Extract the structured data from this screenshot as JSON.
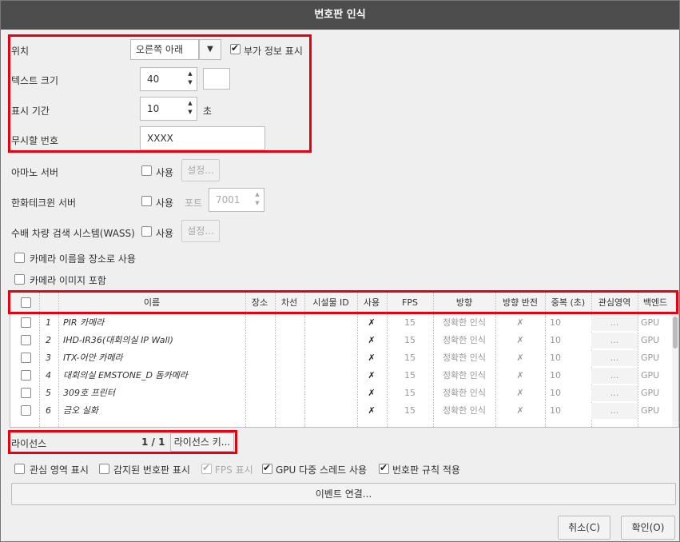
{
  "title": "번호판 인식",
  "display": {
    "position_label": "위치",
    "position_value": "오른쪽 아래",
    "extra_info_label": "부가 정보 표시",
    "text_size_label": "텍스트 크기",
    "text_size_value": "40",
    "duration_label": "표시 기간",
    "duration_value": "10",
    "duration_unit": "초",
    "ignore_label": "무시할 번호",
    "ignore_value": "XXXX"
  },
  "servers": {
    "amano_label": "아마노 서버",
    "use_label": "사용",
    "settings_label": "설정...",
    "hanwha_label": "한화테크윈 서버",
    "port_label": "포트",
    "port_value": "7001",
    "wass_label": "수배 차량 검색 시스템(WASS)"
  },
  "options": {
    "camera_name_location": "카메라 이름을 장소로 사용",
    "include_camera_image": "카메라 이미지 포함"
  },
  "table": {
    "headers": {
      "name": "이름",
      "place": "장소",
      "lane": "차선",
      "facility_id": "시설물 ID",
      "use": "사용",
      "fps": "FPS",
      "direction": "방향",
      "reverse": "방향 반전",
      "duplicate": "중복 (초)",
      "roi": "관심영역",
      "backend": "백엔드"
    },
    "rows": [
      {
        "num": "1",
        "name": "PIR 카메라",
        "use": "✗",
        "fps": "15",
        "direction": "정확한 인식",
        "reverse": "✗",
        "duplicate": "10",
        "roi": "...",
        "backend": "GPU"
      },
      {
        "num": "2",
        "name": "IHD-IR36(대회의실 IP Wall)",
        "use": "✗",
        "fps": "15",
        "direction": "정확한 인식",
        "reverse": "✗",
        "duplicate": "10",
        "roi": "...",
        "backend": "GPU"
      },
      {
        "num": "3",
        "name": "ITX-어안 카메라",
        "use": "✗",
        "fps": "15",
        "direction": "정확한 인식",
        "reverse": "✗",
        "duplicate": "10",
        "roi": "...",
        "backend": "GPU"
      },
      {
        "num": "4",
        "name": "대회의실 EMSTONE_D 돔카메라",
        "use": "✗",
        "fps": "15",
        "direction": "정확한 인식",
        "reverse": "✗",
        "duplicate": "10",
        "roi": "...",
        "backend": "GPU"
      },
      {
        "num": "5",
        "name": "309호 프린터",
        "use": "✗",
        "fps": "15",
        "direction": "정확한 인식",
        "reverse": "✗",
        "duplicate": "10",
        "roi": "...",
        "backend": "GPU"
      },
      {
        "num": "6",
        "name": "금오 실화",
        "use": "✗",
        "fps": "15",
        "direction": "정확한 인식",
        "reverse": "✗",
        "duplicate": "10",
        "roi": "...",
        "backend": "GPU"
      }
    ]
  },
  "license": {
    "label": "라이선스",
    "count": "1 / 1",
    "key_button": "라이선스 키..."
  },
  "bottom_options": {
    "show_roi": "관심 영역 표시",
    "show_detected": "감지된 번호판 표시",
    "show_fps": "FPS 표시",
    "gpu_multithread": "GPU 다중 스레드 사용",
    "apply_rules": "번호판 규칙 적용"
  },
  "event_button": "이벤트 연결...",
  "cancel_button": "취소(C)",
  "ok_button": "확인(O)"
}
